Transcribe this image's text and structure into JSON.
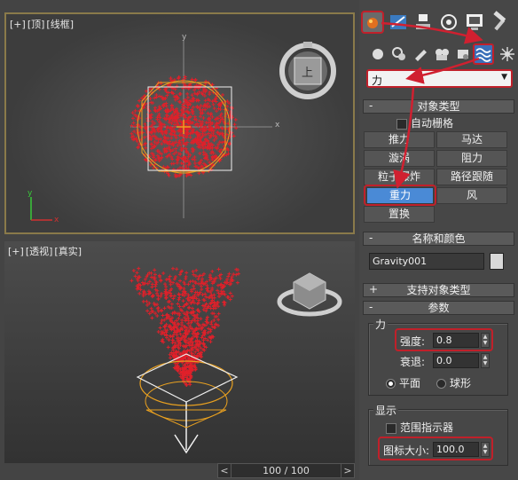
{
  "viewport_top": {
    "label_plus": "[+]",
    "label_view": "[顶]",
    "label_shading": "[线框]",
    "viewcube_face": "上",
    "axis_x": "x",
    "axis_y": "y"
  },
  "viewport_persp": {
    "label_plus": "[+]",
    "label_view": "[透视]",
    "label_shading": "[真实]"
  },
  "timeline": {
    "prev": "<",
    "value": "100 / 100",
    "next": ">"
  },
  "colors": {
    "accent_red": "#c0202a",
    "particle_red": "#e0202a",
    "selected_button": "#4a8ad6",
    "gizmo_orange": "#e8a020"
  },
  "panel": {
    "tabs": [
      "create-icon",
      "modify-icon",
      "hierarchy-icon",
      "motion-icon",
      "display-icon",
      "utilities-icon"
    ],
    "subcategories": [
      "geometry-icon",
      "shapes-icon",
      "lights-icon",
      "cameras-icon",
      "helpers-icon",
      "spacewarps-icon",
      "systems-icon"
    ],
    "category_dropdown": "力",
    "object_type": {
      "title": "对象类型",
      "autogrid": "自动栅格",
      "buttons": [
        "推力",
        "马达",
        "漩涡",
        "阻力",
        "粒子爆炸",
        "路径跟随",
        "重力",
        "风",
        "置换"
      ]
    },
    "name_color": {
      "title": "名称和颜色",
      "name_value": "Gravity001"
    },
    "support_types": {
      "title": "支持对象类型"
    },
    "params": {
      "title": "参数",
      "force_group": "力",
      "strength_label": "强度:",
      "strength_value": "0.8",
      "decay_label": "衰退:",
      "decay_value": "0.0",
      "planar": "平面",
      "spherical": "球形",
      "display_group": "显示",
      "range_indicators": "范围指示器",
      "icon_size_label": "图标大小:",
      "icon_size_value": "100.0"
    }
  }
}
